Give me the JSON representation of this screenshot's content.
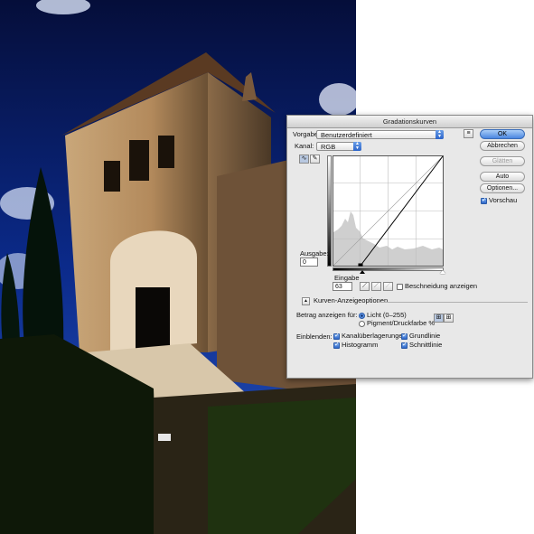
{
  "dialog": {
    "title": "Gradationskurven",
    "preset_label": "Vorgabe:",
    "preset_value": "Benutzerdefiniert",
    "channel_label": "Kanal:",
    "channel_value": "RGB",
    "output_label": "Ausgabe:",
    "output_value": "0",
    "input_label": "Eingabe",
    "input_value": "63",
    "clipping_label": "Beschneidung anzeigen",
    "clipping_checked": false,
    "display_options_label": "Kurven-Anzeigeoptionen",
    "show_amount_label": "Betrag anzeigen für:",
    "light_label": "Licht (0–255)",
    "light_selected": true,
    "pigment_label": "Pigment/Druckfarbe %",
    "pigment_selected": false,
    "show_label": "Einblenden:",
    "channel_overlays_label": "Kanalüberlagerungen",
    "channel_overlays_checked": true,
    "baseline_label": "Grundlinie",
    "baseline_checked": true,
    "histogram_label": "Histogramm",
    "histogram_checked": true,
    "intersection_label": "Schnittlinie",
    "intersection_checked": true,
    "preview_label": "Vorschau",
    "preview_checked": true
  },
  "buttons": {
    "ok": "OK",
    "cancel": "Abbrechen",
    "smooth": "Glätten",
    "auto": "Auto",
    "options": "Optionen..."
  },
  "colors": {
    "accent": "#3a7be0",
    "sky": "#0b1f6e"
  },
  "icons": {
    "curve_tool": "curve-point-icon",
    "pencil_tool": "pencil-icon",
    "black_eyedropper": "eyedropper-black-icon",
    "gray_eyedropper": "eyedropper-gray-icon",
    "white_eyedropper": "eyedropper-white-icon"
  }
}
